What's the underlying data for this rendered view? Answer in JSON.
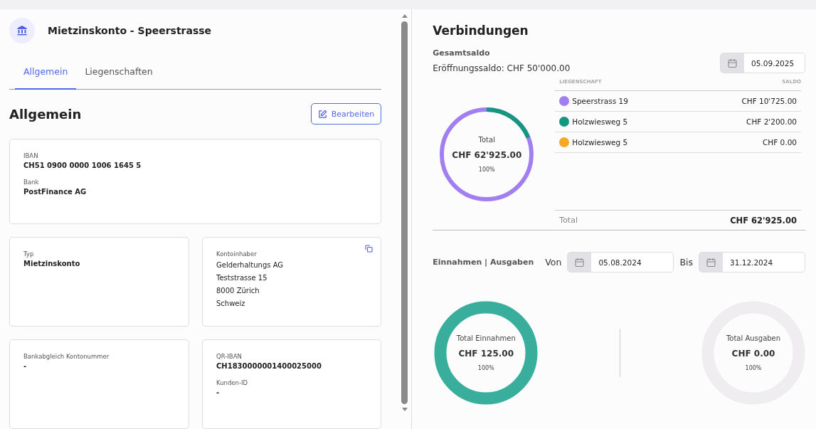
{
  "account": {
    "title": "Mietzinskonto - Speerstrasse"
  },
  "tabs": [
    {
      "label": "Allgemein",
      "selected": true
    },
    {
      "label": "Liegenschaften",
      "selected": false
    }
  ],
  "section": {
    "title": "Allgemein",
    "edit_button": "Bearbeiten"
  },
  "cards": [
    {
      "fields": [
        {
          "label": "IBAN",
          "values": [
            "CH51 0900 0000 1006 1645 5"
          ]
        },
        {
          "label": "Bank",
          "values": [
            "PostFinance AG"
          ]
        }
      ],
      "copy": false
    },
    {
      "fields": [
        {
          "label": "Typ",
          "values": [
            "Mietzinskonto"
          ]
        }
      ],
      "copy": false
    },
    {
      "fields": [
        {
          "label": "Kontoinhaber",
          "values": [
            "Gelderhaltungs AG",
            "Teststrasse 15",
            "8000 Zürich",
            "Schweiz"
          ]
        }
      ],
      "copy": true
    },
    {
      "fields": [
        {
          "label": "Bankabgleich Kontonummer",
          "values": [
            "-"
          ]
        }
      ],
      "copy": false
    },
    {
      "fields": [
        {
          "label": "QR-IBAN",
          "values": [
            "CH1830000001400025000"
          ]
        },
        {
          "label": "Kunden-ID",
          "values": [
            "-"
          ]
        }
      ],
      "copy": false
    }
  ],
  "connections": {
    "title": "Verbindungen",
    "balance_title": "Gesamtsaldo",
    "opening_balance": "Eröffnungssaldo: CHF 50'000.00",
    "date": "05.09.2025",
    "donut": {
      "label": "Total",
      "amount": "CHF 62'925.00",
      "percent": "100%"
    },
    "columns": [
      "LIEGENSCHAFT",
      "SALDO"
    ],
    "rows": [
      {
        "name": "Speerstrass 19",
        "amount": "CHF 10'725.00",
        "color": "#a27ff0"
      },
      {
        "name": "Holzwiesweg 5",
        "amount": "CHF 2'200.00",
        "color": "#14967f"
      },
      {
        "name": "Holzwiesweg 5",
        "amount": "CHF 0.00",
        "color": "#f9a825"
      }
    ],
    "total": {
      "label": "Total",
      "amount": "CHF 62'925.00"
    }
  },
  "income_expenses": {
    "title": "Einnahmen | Ausgaben",
    "from_label": "Von",
    "from_date": "05.08.2024",
    "to_label": "Bis",
    "to_date": "31.12.2024",
    "totals": [
      {
        "label": "Total Einnahmen",
        "amount": "CHF 125.00",
        "percent": "100%",
        "kind": "income"
      },
      {
        "label": "Total Ausgaben",
        "amount": "CHF 0.00",
        "percent": "100%",
        "kind": "expenses"
      }
    ]
  }
}
